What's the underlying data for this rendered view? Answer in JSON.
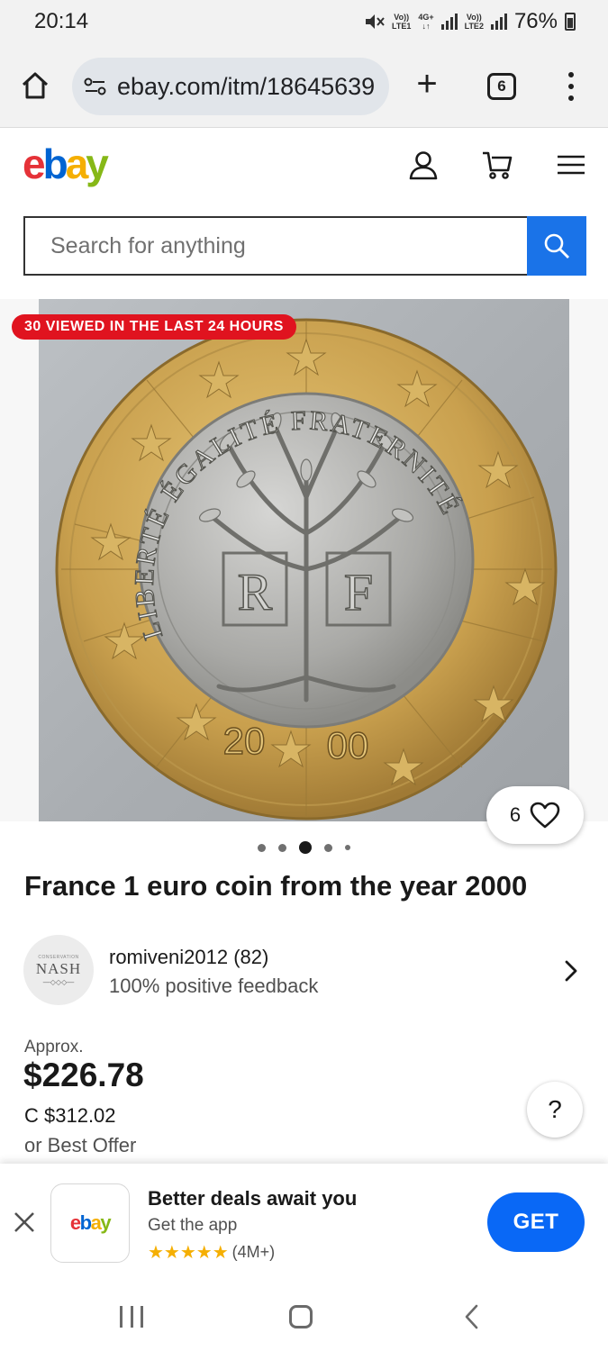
{
  "status_bar": {
    "time": "20:14",
    "sim1_tag_top": "Vo))",
    "sim1_tag_bottom": "LTE1",
    "net_tag_top": "4G+",
    "net_tag_bottom": "↓↑",
    "sim2_tag_top": "Vo))",
    "sim2_tag_bottom": "LTE2",
    "battery": "76%",
    "icons": [
      "mute-icon",
      "signal-icon",
      "battery-icon"
    ]
  },
  "browser": {
    "url": "ebay.com/itm/18645639",
    "tab_count": "6",
    "icons": [
      "home-icon",
      "site-settings-icon",
      "new-tab-icon",
      "tabs-icon",
      "more-vert-icon"
    ]
  },
  "header": {
    "logo": {
      "e": "e",
      "b": "b",
      "a": "a",
      "y": "y"
    },
    "colors": {
      "e": "#e53238",
      "b": "#0064d2",
      "a": "#f5af02",
      "y": "#86b817"
    },
    "icons": [
      "account-icon",
      "cart-icon",
      "hamburger-icon"
    ]
  },
  "search": {
    "placeholder": "Search for anything",
    "button_color": "#1a73e8"
  },
  "listing": {
    "viewed_badge": "30 VIEWED IN THE LAST 24 HOURS",
    "watch_count": "6",
    "image_dots": {
      "count": 5,
      "active_index": 2
    },
    "coin_text": {
      "arc": "LIBERTÉ ÉGALITÉ FRATERNITÉ",
      "initial_left": "R",
      "initial_right": "F",
      "year_left": "20",
      "year_right": "00"
    },
    "title": "France 1 euro coin from the year 2000"
  },
  "seller": {
    "avatar_top": "CONSERVATION",
    "avatar_name": "NASH",
    "avatar_ornament": "—◇◇◇—",
    "name": "romiveni2012 (82)",
    "feedback": "100% positive feedback"
  },
  "price": {
    "approx_label": "Approx.",
    "amount": "$226.78",
    "converted": "C $312.02",
    "best_offer": "or Best Offer",
    "help": "?"
  },
  "app_banner": {
    "logo": {
      "e": "e",
      "b": "b",
      "a": "a",
      "y": "y"
    },
    "title": "Better deals await you",
    "subtitle": "Get the app",
    "stars": "★★★★★",
    "rating_count": "(4M+)",
    "get_label": "GET",
    "get_color": "#0968f6"
  },
  "nav": {
    "icons": [
      "recents-icon",
      "home-nav-icon",
      "back-icon"
    ]
  }
}
